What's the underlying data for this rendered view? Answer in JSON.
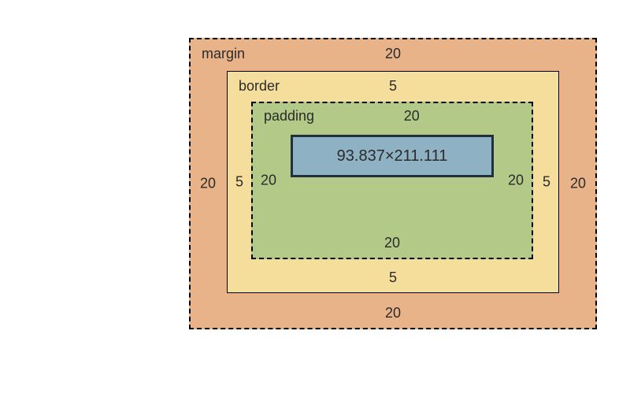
{
  "box_model": {
    "margin": {
      "label": "margin",
      "top": "20",
      "right": "20",
      "bottom": "20",
      "left": "20"
    },
    "border": {
      "label": "border",
      "top": "5",
      "right": "5",
      "bottom": "5",
      "left": "5"
    },
    "padding": {
      "label": "padding",
      "top": "20",
      "right": "20",
      "bottom": "20",
      "left": "20"
    },
    "content": {
      "text": "93.837×211.111"
    }
  },
  "colors": {
    "margin": "#e8b388",
    "border": "#f5dd9c",
    "padding": "#b3c987",
    "content": "#8fb1c4"
  }
}
